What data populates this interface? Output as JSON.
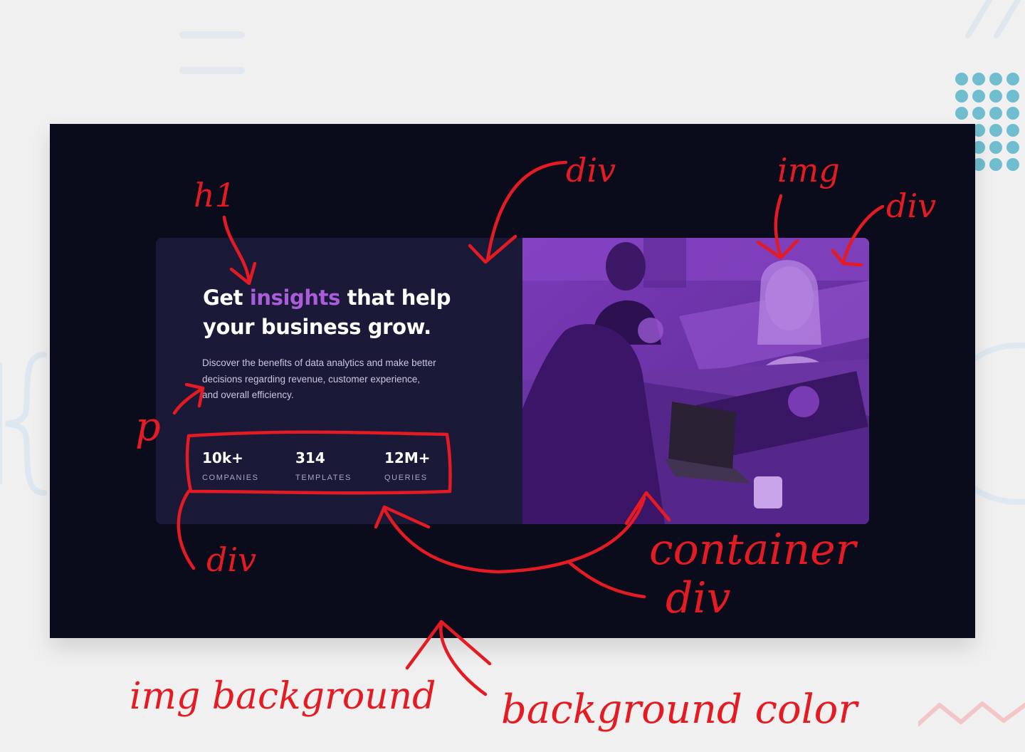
{
  "hero": {
    "headline_before": "Get ",
    "headline_highlight": "insights",
    "headline_after": " that help your business grow.",
    "description": "Discover the benefits of data analytics and make better decisions regarding revenue, customer experience, and overall efficiency."
  },
  "stats": [
    {
      "value": "10k+",
      "label": "COMPANIES"
    },
    {
      "value": "314",
      "label": "TEMPLATES"
    },
    {
      "value": "12M+",
      "label": "QUERIES"
    }
  ],
  "photo": {
    "icon": "office-team-photo",
    "overlay_color": "#aa5cdb"
  },
  "annotations": {
    "h1": "h1",
    "div_top": "div",
    "img": "img",
    "div_right": "div",
    "p": "p",
    "div_stats": "div",
    "container_div_1": "container",
    "container_div_2": "div",
    "img_background": "img background",
    "background_color": "background color"
  },
  "colors": {
    "page_bg": "#f0f0f1",
    "frame_bg": "#0a0c1c",
    "card_bg": "#1b1938",
    "accent": "#aa5cdb",
    "annotation": "#e41b22"
  }
}
